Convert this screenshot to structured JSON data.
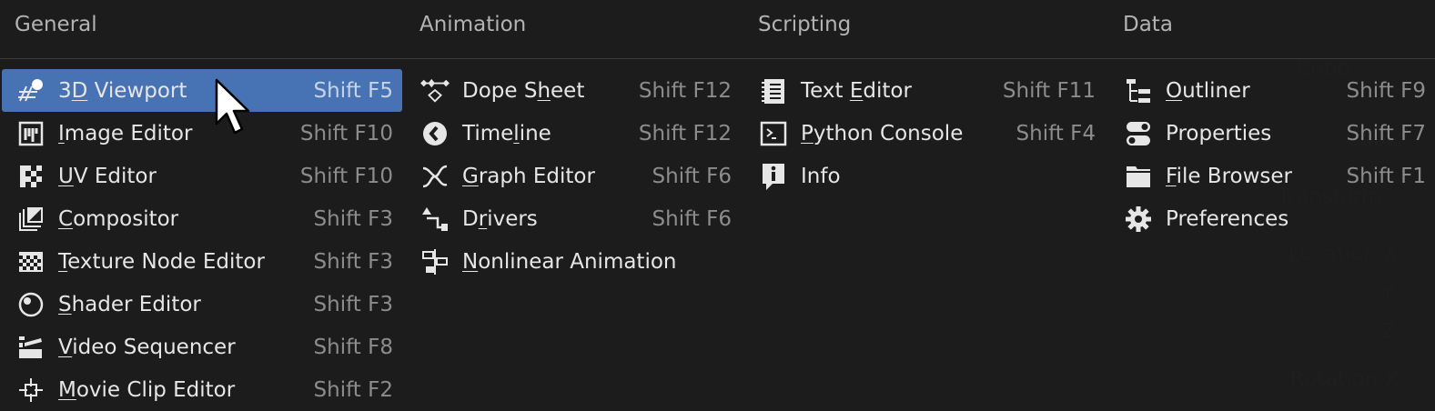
{
  "columns": [
    {
      "title": "General",
      "items": [
        {
          "label": "3D Viewport",
          "mn": "D",
          "pre": "3",
          "post": " Viewport",
          "shortcut": "Shift F5",
          "icon": "viewport-3d-icon",
          "active": true
        },
        {
          "label": "Image Editor",
          "pre": "",
          "mn": "I",
          "post": "mage Editor",
          "shortcut": "Shift F10",
          "icon": "image-editor-icon"
        },
        {
          "label": "UV Editor",
          "pre": "",
          "mn": "U",
          "post": "V Editor",
          "shortcut": "Shift F10",
          "icon": "uv-editor-icon"
        },
        {
          "label": "Compositor",
          "pre": "",
          "mn": "C",
          "post": "ompositor",
          "shortcut": "Shift F3",
          "icon": "compositor-icon"
        },
        {
          "label": "Texture Node Editor",
          "pre": "",
          "mn": "T",
          "post": "exture Node Editor",
          "shortcut": "Shift F3",
          "icon": "texture-node-icon"
        },
        {
          "label": "Shader Editor",
          "pre": "",
          "mn": "S",
          "post": "hader Editor",
          "shortcut": "Shift F3",
          "icon": "shader-editor-icon"
        },
        {
          "label": "Video Sequencer",
          "pre": "",
          "mn": "V",
          "post": "ideo Sequencer",
          "shortcut": "Shift F8",
          "icon": "video-sequencer-icon"
        },
        {
          "label": "Movie Clip Editor",
          "pre": "",
          "mn": "M",
          "post": "ovie Clip Editor",
          "shortcut": "Shift F2",
          "icon": "movie-clip-icon"
        }
      ]
    },
    {
      "title": "Animation",
      "items": [
        {
          "label": "Dope Sheet",
          "pre": "Dope S",
          "mn": "h",
          "post": "eet",
          "shortcut": "Shift F12",
          "icon": "dope-sheet-icon"
        },
        {
          "label": "Timeline",
          "pre": "Time",
          "mn": "l",
          "post": "ine",
          "shortcut": "Shift F12",
          "icon": "timeline-icon"
        },
        {
          "label": "Graph Editor",
          "pre": "",
          "mn": "G",
          "post": "raph Editor",
          "shortcut": "Shift F6",
          "icon": "graph-editor-icon"
        },
        {
          "label": "Drivers",
          "pre": "D",
          "mn": "r",
          "post": "ivers",
          "shortcut": "Shift F6",
          "icon": "drivers-icon"
        },
        {
          "label": "Nonlinear Animation",
          "pre": "",
          "mn": "N",
          "post": "onlinear Animation",
          "shortcut": "",
          "icon": "nla-icon"
        }
      ]
    },
    {
      "title": "Scripting",
      "items": [
        {
          "label": "Text Editor",
          "pre": "Text ",
          "mn": "E",
          "post": "ditor",
          "shortcut": "Shift F11",
          "icon": "text-editor-icon"
        },
        {
          "label": "Python Console",
          "pre": "",
          "mn": "P",
          "post": "ython Console",
          "shortcut": "Shift F4",
          "icon": "python-console-icon"
        },
        {
          "label": "Info",
          "pre": "Info",
          "mn": "",
          "post": "",
          "shortcut": "",
          "icon": "info-icon"
        }
      ]
    },
    {
      "title": "Data",
      "items": [
        {
          "label": "Outliner",
          "pre": "",
          "mn": "O",
          "post": "utliner",
          "shortcut": "Shift F9",
          "icon": "outliner-icon"
        },
        {
          "label": "Properties",
          "pre": "Properties",
          "mn": "",
          "post": "",
          "shortcut": "Shift F7",
          "icon": "properties-icon"
        },
        {
          "label": "File Browser",
          "pre": "",
          "mn": "F",
          "post": "ile Browser",
          "shortcut": "Shift F1",
          "icon": "file-browser-icon"
        },
        {
          "label": "Preferences",
          "pre": "Preferences",
          "mn": "",
          "post": "",
          "shortcut": "",
          "icon": "preferences-icon"
        }
      ]
    }
  ],
  "background": {
    "texts": [
      "Cube",
      "Cube",
      "Transform",
      "Location X",
      "Y",
      "Z",
      "Rotation X"
    ]
  },
  "colors": {
    "accent": "#4772b3",
    "text": "#e6e6e6",
    "shortcut": "#8c8c8c",
    "header": "#b3b3b3"
  }
}
